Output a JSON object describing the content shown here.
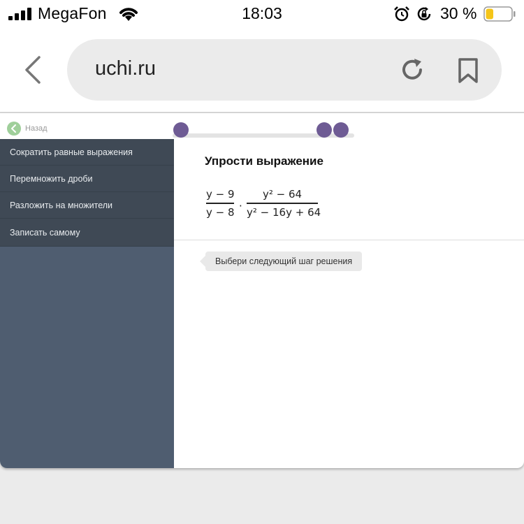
{
  "status": {
    "carrier": "MegaFon",
    "time": "18:03",
    "battery_percent": "30 %",
    "battery_level": 0.3,
    "battery_color": "#f5c518"
  },
  "browser": {
    "url": "uchi.ru",
    "icons": [
      "chevron-left-icon",
      "reload-icon",
      "bookmark-icon"
    ]
  },
  "page": {
    "back_label": "Назад",
    "accent_color": "#6e5b94",
    "menu": [
      {
        "label": "Сократить равные выражения"
      },
      {
        "label": "Перемножить дроби"
      },
      {
        "label": "Разложить на множители"
      },
      {
        "label": "Записать самому"
      }
    ],
    "task_title": "Упрости выражение",
    "expression": {
      "frac1_num": "y − 9",
      "frac1_den": "y − 8",
      "operator": "·",
      "frac2_num": "y² − 64",
      "frac2_den": "y² − 16y + 64"
    },
    "hint": "Выбери следующий шаг решения"
  }
}
